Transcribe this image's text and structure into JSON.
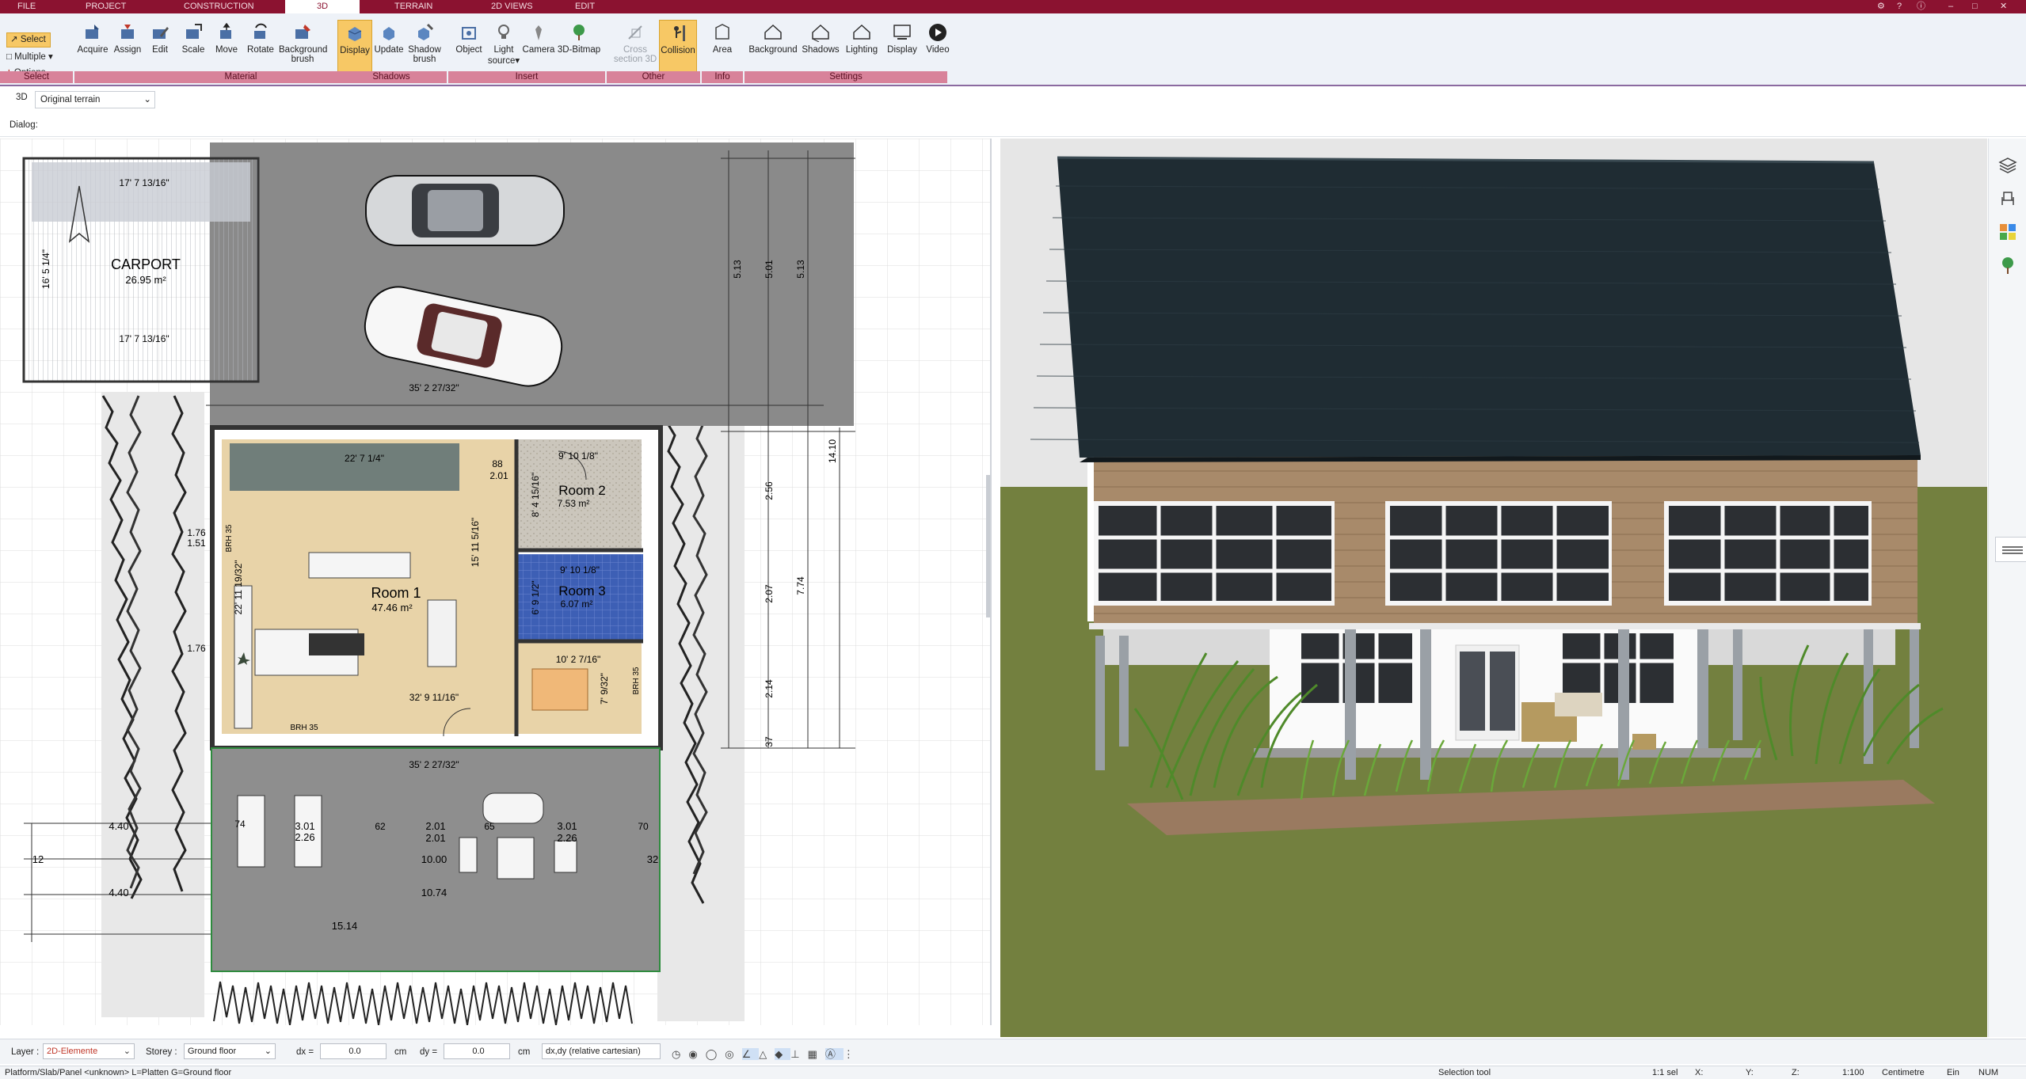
{
  "menu": {
    "tabs": [
      "FILE",
      "PROJECT",
      "CONSTRUCTION",
      "3D",
      "TERRAIN",
      "2D VIEWS",
      "EDIT"
    ],
    "active_tab": "3D"
  },
  "ribbon": {
    "select": {
      "select_label": "Select",
      "multiple_label": "Multiple",
      "options_label": "Options"
    },
    "buttons": {
      "acquire": "Acquire",
      "assign": "Assign",
      "edit": "Edit",
      "scale": "Scale",
      "move": "Move",
      "rotate": "Rotate",
      "bg_brush_1": "Background",
      "bg_brush_2": "brush",
      "display": "Display",
      "update": "Update",
      "shadow_brush_1": "Shadow",
      "shadow_brush_2": "brush",
      "object": "Object",
      "light_1": "Light",
      "light_2": "source",
      "camera": "Camera",
      "bitmap": "3D-Bitmap",
      "cross_1": "Cross",
      "cross_2": "section 3D",
      "collision": "Collision",
      "area": "Area",
      "background": "Background",
      "shadows": "Shadows",
      "lighting": "Lighting",
      "display2": "Display",
      "video": "Video"
    },
    "groups": {
      "select": "Select",
      "material": "Material",
      "shadows": "Shadows",
      "insert": "Insert",
      "other": "Other",
      "info": "Info",
      "settings": "Settings"
    }
  },
  "subbar": {
    "mode": "3D",
    "terrain_select": "Original terrain",
    "dialog_label": "Dialog:"
  },
  "plan": {
    "carport_label": "CARPORT",
    "carport_area": "26.95 m²",
    "room1_label": "Room 1",
    "room1_area": "47.46 m²",
    "room2_label": "Room 2",
    "room2_area": "7.53 m²",
    "room3_label": "Room 3",
    "room3_area": "6.07 m²",
    "dims": {
      "carport_top": "17' 7 13/16\"",
      "carport_bottom": "17' 7 13/16\"",
      "carport_side": "16' 5 1/4\"",
      "driveway_width": "35' 2 27/32\"",
      "terrace_width": "35' 2 27/32\"",
      "top_wall": "22' 7 1/4\"",
      "room2_width": "9' 10 1/8\"",
      "room3_width": "9' 10 1/8\"",
      "room1_height": "15' 11 5/16\"",
      "room1_left": "22' 11 19/32\"",
      "room1_bottom": "32' 9 11/16\"",
      "kitchen_dim": "10' 2 7/16\"",
      "side_dim": "7' 9/32\"",
      "room2_h": "8' 4 15/16\"",
      "room3_h": "6' 9 1/2\"",
      "d_88": "88",
      "d_201": "2.01",
      "d_513a": "5.13",
      "d_501": "5.01",
      "d_513b": "5.13",
      "d_1410": "14.10",
      "d_774": "7.74",
      "d_256": "2.56",
      "d_207": "2.07",
      "d_214": "2.14",
      "d_226": "2.26",
      "d_301a": "3.01",
      "d_201b": "2.01",
      "d_301b": "3.01",
      "d_1000": "10.00",
      "d_1074": "10.74",
      "d_1514": "15.14",
      "d_440a": "4.40",
      "d_440b": "4.40",
      "d_74": "74",
      "d_62": "62",
      "d_65": "65",
      "d_70": "70",
      "d_12": "12",
      "d_32": "32",
      "d_176a": "1.76",
      "d_151": "1.51",
      "d_176b": "1.76",
      "d_37": "37",
      "brh": "BRH 35"
    }
  },
  "bottombar": {
    "layer_label": "Layer :",
    "layer_value": "2D-Elemente",
    "storey_label": "Storey :",
    "storey_value": "Ground floor",
    "dx_label": "dx =",
    "dx_value": "0.0",
    "dy_label": "dy =",
    "dy_value": "0.0",
    "unit": "cm",
    "coord_mode": "dx,dy (relative cartesian)"
  },
  "status": {
    "left": "Platform/Slab/Panel <unknown> L=Platten G=Ground floor",
    "tool": "Selection tool",
    "sel": "1:1 sel",
    "x": "X:",
    "y": "Y:",
    "z": "Z:",
    "scale": "1:100",
    "unit": "Centimetre",
    "ein": "Ein",
    "num": "NUM"
  },
  "colors": {
    "accent": "#8b1230",
    "ribbon_group": "#d8829a",
    "active_tool": "#f7c865",
    "roof": "#1f2c33",
    "sky": "#e6e6e6",
    "grass": "#6f7d3c"
  }
}
